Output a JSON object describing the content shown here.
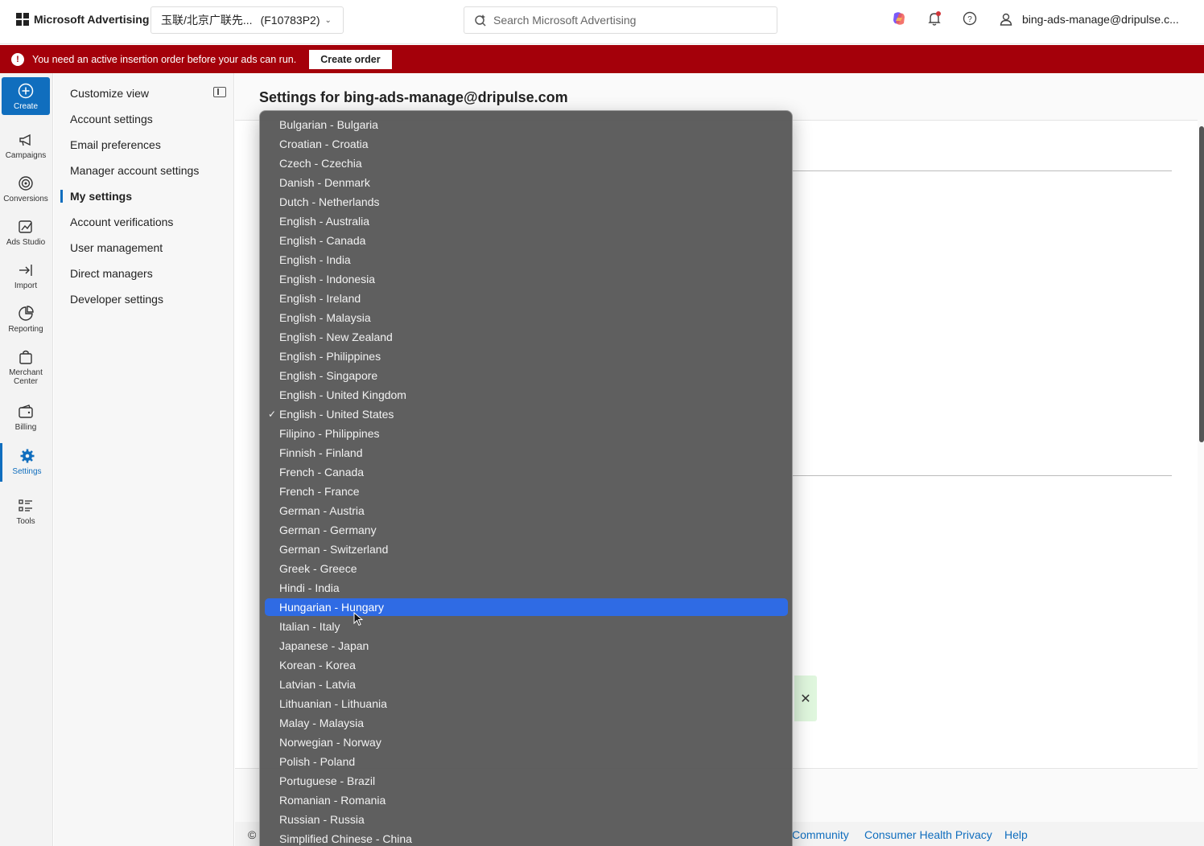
{
  "topbar": {
    "brand": "Microsoft Advertising",
    "account_name": "玉联/北京广联先...",
    "account_id": "(F10783P2)",
    "search_placeholder": "Search Microsoft Advertising",
    "user_email": "bing-ads-manage@dripulse.c..."
  },
  "banner": {
    "message": "You need an active insertion order before your ads can run.",
    "button": "Create order",
    "color": "#a4000a"
  },
  "rail": {
    "items": [
      {
        "label": "Create",
        "icon": "plus-circle-icon"
      },
      {
        "label": "Campaigns",
        "icon": "megaphone-icon"
      },
      {
        "label": "Conversions",
        "icon": "target-icon"
      },
      {
        "label": "Ads Studio",
        "icon": "ads-studio-icon"
      },
      {
        "label": "Import",
        "icon": "import-icon"
      },
      {
        "label": "Reporting",
        "icon": "reporting-icon"
      },
      {
        "label": "Merchant Center",
        "icon": "merchant-icon"
      },
      {
        "label": "Billing",
        "icon": "wallet-icon"
      },
      {
        "label": "Settings",
        "icon": "gear-icon"
      },
      {
        "label": "Tools",
        "icon": "tools-icon"
      }
    ],
    "active": "Settings"
  },
  "settings_nav": {
    "items": [
      "Customize view",
      "Account settings",
      "Email preferences",
      "Manager account settings",
      "My settings",
      "Account verifications",
      "User management",
      "Direct managers",
      "Developer settings"
    ],
    "active": "My settings"
  },
  "main": {
    "title": "Settings for bing-ads-manage@dripulse.com"
  },
  "footer": {
    "copyright": "©",
    "links": [
      "Community",
      "Consumer Health Privacy",
      "Help"
    ]
  },
  "language_dropdown": {
    "selected": "English - United States",
    "highlighted": "Hungarian - Hungary",
    "highlight_color": "#2f6be4",
    "options": [
      "Bulgarian - Bulgaria",
      "Croatian - Croatia",
      "Czech - Czechia",
      "Danish - Denmark",
      "Dutch - Netherlands",
      "English - Australia",
      "English - Canada",
      "English - India",
      "English - Indonesia",
      "English - Ireland",
      "English - Malaysia",
      "English - New Zealand",
      "English - Philippines",
      "English - Singapore",
      "English - United Kingdom",
      "English - United States",
      "Filipino - Philippines",
      "Finnish - Finland",
      "French - Canada",
      "French - France",
      "German - Austria",
      "German - Germany",
      "German - Switzerland",
      "Greek - Greece",
      "Hindi - India",
      "Hungarian - Hungary",
      "Italian - Italy",
      "Japanese - Japan",
      "Korean - Korea",
      "Latvian - Latvia",
      "Lithuanian - Lithuania",
      "Malay - Malaysia",
      "Norwegian - Norway",
      "Polish - Poland",
      "Portuguese - Brazil",
      "Romanian - Romania",
      "Russian - Russia",
      "Simplified Chinese - China"
    ]
  }
}
